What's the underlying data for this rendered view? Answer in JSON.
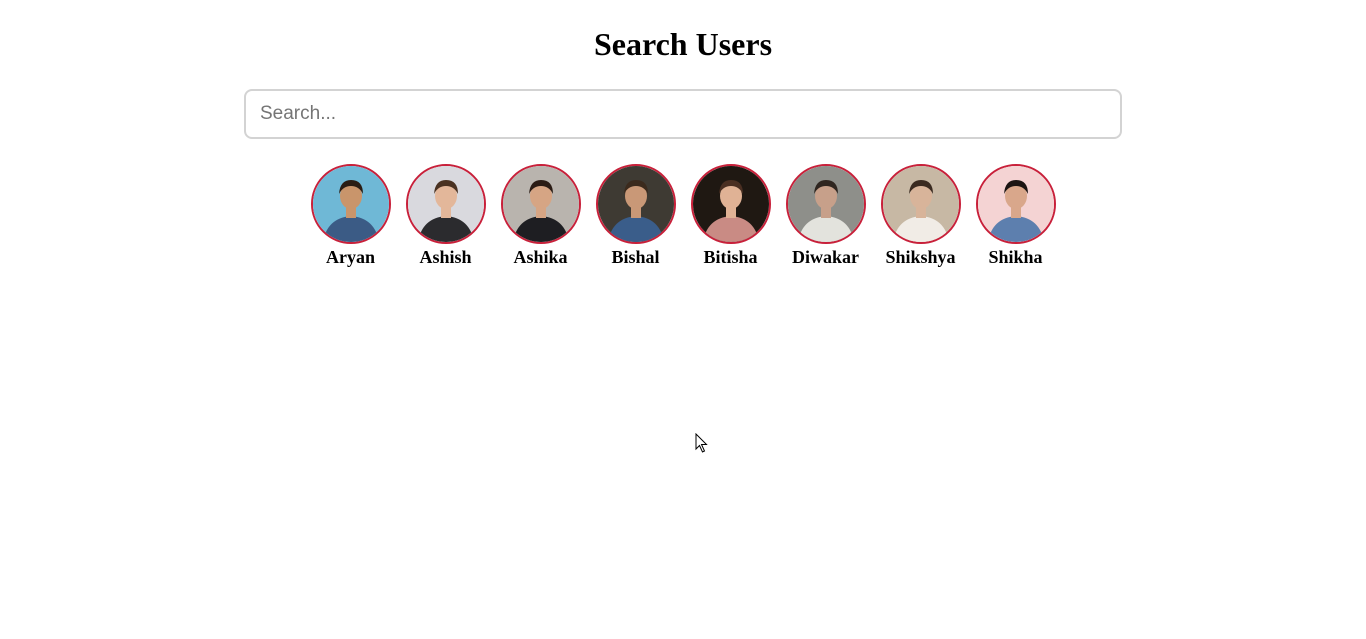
{
  "header": {
    "title": "Search Users"
  },
  "search": {
    "placeholder": "Search...",
    "value": ""
  },
  "users": [
    {
      "name": "Aryan",
      "bg": "#6fb8d6",
      "skin": "#c9956b",
      "hair": "#2a1d14",
      "shirt": "#3b5b85"
    },
    {
      "name": "Ashish",
      "bg": "#d9d9de",
      "skin": "#e3b79a",
      "hair": "#4a3222",
      "shirt": "#2b2b2e"
    },
    {
      "name": "Ashika",
      "bg": "#b9b4ae",
      "skin": "#d6a584",
      "hair": "#2b1c15",
      "shirt": "#1e1e22"
    },
    {
      "name": "Bishal",
      "bg": "#3e3a33",
      "skin": "#c99877",
      "hair": "#3b2a1d",
      "shirt": "#3a5d8a"
    },
    {
      "name": "Bitisha",
      "bg": "#1f1812",
      "skin": "#e0b295",
      "hair": "#4a2f22",
      "shirt": "#c98b84"
    },
    {
      "name": "Diwakar",
      "bg": "#8e8f8a",
      "skin": "#c7a08a",
      "hair": "#2f2620",
      "shirt": "#e3e3dd"
    },
    {
      "name": "Shikshya",
      "bg": "#c7b8a4",
      "skin": "#d8b49a",
      "hair": "#3a2a20",
      "shirt": "#f1ece6"
    },
    {
      "name": "Shikha",
      "bg": "#f4d3d3",
      "skin": "#d9a78b",
      "hair": "#1b1412",
      "shirt": "#5d7fae"
    }
  ]
}
